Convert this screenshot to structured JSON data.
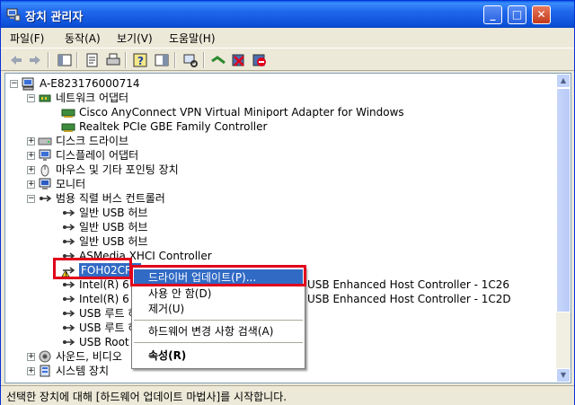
{
  "window": {
    "title": "장치 관리자",
    "buttons": {
      "minimize": "_",
      "maximize": "□",
      "close": "✕"
    }
  },
  "menu": [
    "파일(F)",
    "동작(A)",
    "보기(V)",
    "도움말(H)"
  ],
  "toolbar": [
    "back",
    "forward",
    "show-hide-tree",
    "properties",
    "print",
    "help",
    "view-toggle",
    "scan-hardware",
    "update-driver",
    "uninstall",
    "disable"
  ],
  "tree": {
    "root": "A-E823176000714",
    "items": [
      {
        "label": "네트워크 어댑터",
        "expanded": true,
        "icon": "network-icon"
      },
      {
        "label": "Cisco AnyConnect VPN Virtual Miniport Adapter for Windows",
        "icon": "network-card-icon"
      },
      {
        "label": "Realtek PCIe GBE Family Controller",
        "icon": "network-card-icon"
      },
      {
        "label": "디스크 드라이브",
        "expanded": false,
        "icon": "disk-icon"
      },
      {
        "label": "디스플레이 어댑터",
        "expanded": false,
        "icon": "display-icon"
      },
      {
        "label": "마우스 및 기타 포인팅 장치",
        "expanded": false,
        "icon": "mouse-icon"
      },
      {
        "label": "모니터",
        "expanded": false,
        "icon": "monitor-icon"
      },
      {
        "label": "범용 직렬 버스 컨트롤러",
        "expanded": true,
        "icon": "usb-icon"
      },
      {
        "label": "일반 USB 허브",
        "icon": "usb-icon"
      },
      {
        "label": "일반 USB 허브",
        "icon": "usb-icon"
      },
      {
        "label": "일반 USB 허브",
        "icon": "usb-icon"
      },
      {
        "label": "ASMedia XHCI Controller",
        "icon": "usb-icon"
      },
      {
        "label": "FOH02CRP",
        "icon": "usb-warning-icon",
        "selected": true
      },
      {
        "label": "Intel(R) 6 S",
        "suffix": "USB Enhanced Host Controller - 1C26",
        "icon": "usb-icon"
      },
      {
        "label": "Intel(R) 6 S",
        "suffix": "USB Enhanced Host Controller - 1C2D",
        "icon": "usb-icon"
      },
      {
        "label": "USB 루트 허",
        "icon": "usb-icon"
      },
      {
        "label": "USB 루트 허",
        "icon": "usb-icon"
      },
      {
        "label": "USB Root H",
        "icon": "usb-icon"
      },
      {
        "label": "사운드, 비디오",
        "expanded": false,
        "icon": "sound-icon"
      },
      {
        "label": "시스템 장치",
        "expanded": false,
        "icon": "system-icon"
      }
    ]
  },
  "context_menu": {
    "items": [
      {
        "label": "드라이버 업데이트(P)...",
        "highlighted": true
      },
      {
        "label": "사용 안 함(D)"
      },
      {
        "label": "제거(U)"
      },
      {
        "separator": true
      },
      {
        "label": "하드웨어 변경 사항 검색(A)"
      },
      {
        "separator": true
      },
      {
        "label": "속성(R)",
        "bold": true
      }
    ]
  },
  "status": "선택한 장치에 대해 [하드웨어 업데이트 마법사]를 시작합니다."
}
